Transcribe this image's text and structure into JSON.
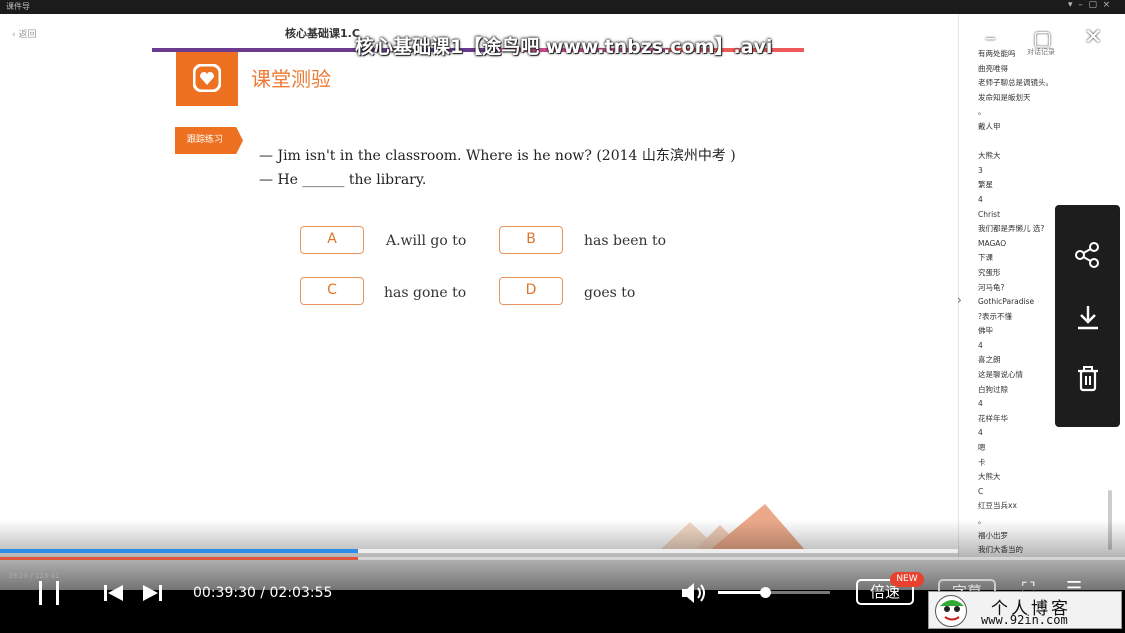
{
  "inner_app": {
    "app_name": "课件导",
    "back_label": "返回",
    "slide_small_title": "核心基础课1.C",
    "panel_header": "对话记录",
    "inner_time": "39:28 / 123:41"
  },
  "video": {
    "title": "核心基础课1【途鸟吧 www.tnbzs.com】.avi",
    "current_time": "00:39:30",
    "separator": "/",
    "total_time": "02:03:55",
    "played_fraction": 0.318,
    "slide_progress_fraction": 0.374,
    "volume_fraction": 0.42,
    "speed_label": "倍速",
    "new_badge": "NEW",
    "subtitle_label": "字幕"
  },
  "slide": {
    "section_title": "课堂测验",
    "tag_label": "跟踪练习",
    "question_line1": "— Jim isn't in the classroom. Where is he now? (2014 山东滨州中考 )",
    "question_line2": "— He ______ the library.",
    "options": [
      {
        "letter": "A",
        "text": "A.will go to"
      },
      {
        "letter": "B",
        "text": "has been to"
      },
      {
        "letter": "C",
        "text": "has gone to"
      },
      {
        "letter": "D",
        "text": "goes to"
      }
    ]
  },
  "chat_messages": [
    "有两处能吗",
    "曲亮唯得",
    "老师子聊总是调镜头。",
    "发命知是皈划天",
    "。",
    "戴人甲",
    "",
    "大熊大",
    "3",
    "繁星",
    "4",
    "Christ",
    "我们都是弄懒儿 选?",
    "MAGAO",
    "下课",
    "究蛋形",
    "河马龟?",
    "GothicParadise",
    "?表示不懂",
    "佛毕",
    "4",
    "喜之朗",
    "这是聊说心情",
    "白狗过隙",
    "4",
    "花样年华",
    "4",
    "嗯",
    "卡",
    "大熊大",
    "C",
    "红豆当兵xx",
    "。",
    "福小出罗",
    "我们大香当的"
  ],
  "watermark": {
    "line1": "个人博客",
    "line2": "www.92in.com"
  },
  "colors": {
    "accent_orange": "#ed7120",
    "progress_blue": "#2e8de8",
    "seek_red": "#e0563d",
    "badge_red": "#e8412f"
  },
  "icons": [
    "pause-icon",
    "prev-icon",
    "next-icon",
    "volume-icon",
    "fullscreen-icon",
    "playlist-icon",
    "share-icon",
    "download-icon",
    "trash-icon",
    "minimize-icon",
    "maximize-icon",
    "close-icon",
    "heart-icon"
  ]
}
